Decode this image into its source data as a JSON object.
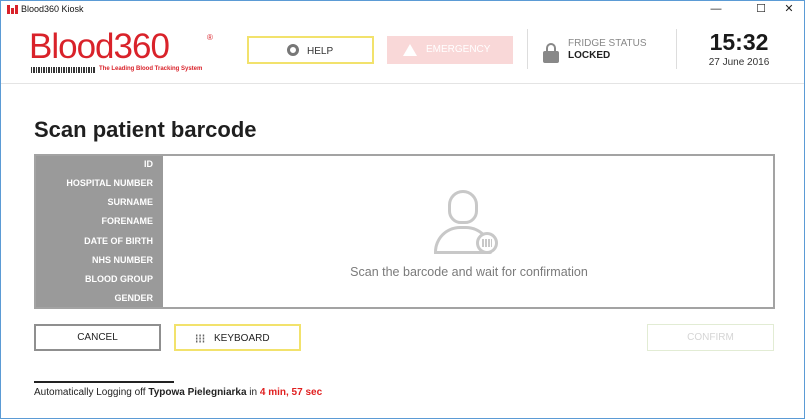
{
  "window": {
    "title": "Blood360 Kiosk",
    "controls": {
      "minimize": "—",
      "maximize": "☐",
      "close": "✕"
    }
  },
  "logo": {
    "name": "Blood360",
    "tagline": "The Leading Blood Tracking System",
    "registered": "®",
    "color": "#d9222a"
  },
  "header": {
    "help_label": "HELP",
    "help_icon": "lifebuoy-icon",
    "emergency_label": "EMERGENCY",
    "emergency_icon": "warning-icon",
    "fridge_status_label": "FRIDGE STATUS",
    "fridge_status_value": "LOCKED",
    "fridge_icon": "lock-icon",
    "time": "15:32",
    "date": "27 June 2016"
  },
  "main": {
    "title": "Scan patient barcode",
    "fields": [
      "ID",
      "HOSPITAL NUMBER",
      "SURNAME",
      "FORENAME",
      "DATE OF BIRTH",
      "NHS NUMBER",
      "BLOOD GROUP",
      "GENDER"
    ],
    "scan_icon": "user-barcode-icon",
    "scan_message": "Scan the barcode and wait for confirmation"
  },
  "actions": {
    "cancel_label": "CANCEL",
    "keyboard_label": "KEYBOARD",
    "keyboard_icon": "keyboard-icon",
    "confirm_label": "CONFIRM"
  },
  "logoff": {
    "prefix": "Automatically Logging off ",
    "user": "Typowa Pielegniarka",
    "middle": " in ",
    "remaining": "4 min, 57 sec"
  },
  "colors": {
    "accent_yellow": "#f2e26c",
    "emergency_bg": "#f9d8d8",
    "label_panel": "#9a9a9a",
    "countdown": "#e02020"
  }
}
